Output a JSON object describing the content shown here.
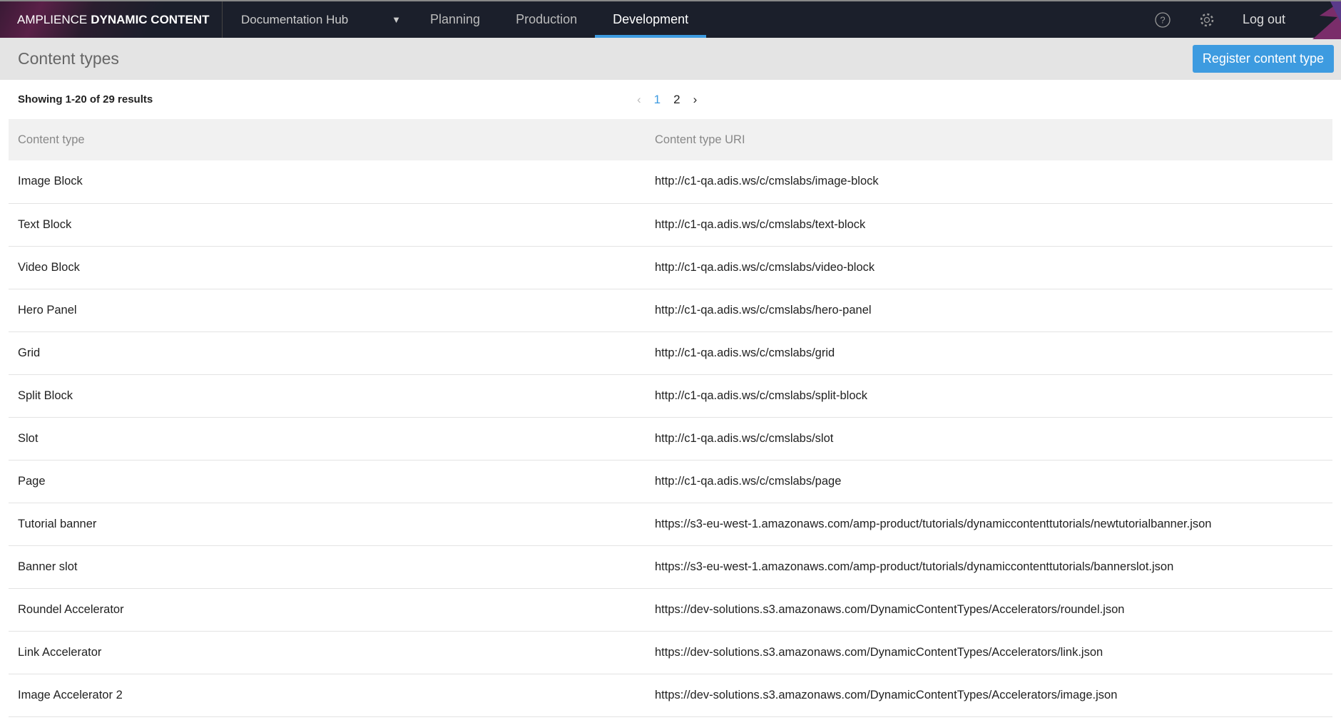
{
  "nav": {
    "brand_light": "AMPLIENCE",
    "brand_bold": "DYNAMIC CONTENT",
    "hub": "Documentation Hub",
    "tabs": [
      {
        "label": "Planning"
      },
      {
        "label": "Production"
      },
      {
        "label": "Development",
        "active": true
      }
    ],
    "help_icon": "help-circle-icon",
    "settings_icon": "gear-icon",
    "logout": "Log out"
  },
  "page": {
    "title": "Content types",
    "register_button": "Register content type",
    "showing": "Showing 1-20 of 29 results",
    "pages": [
      "1",
      "2"
    ],
    "current_page": "1"
  },
  "table": {
    "headers": [
      "Content type",
      "Content type URI"
    ],
    "rows": [
      [
        "Image Block",
        "http://c1-qa.adis.ws/c/cmslabs/image-block"
      ],
      [
        "Text Block",
        "http://c1-qa.adis.ws/c/cmslabs/text-block"
      ],
      [
        "Video Block",
        "http://c1-qa.adis.ws/c/cmslabs/video-block"
      ],
      [
        "Hero Panel",
        "http://c1-qa.adis.ws/c/cmslabs/hero-panel"
      ],
      [
        "Grid",
        "http://c1-qa.adis.ws/c/cmslabs/grid"
      ],
      [
        "Split Block",
        "http://c1-qa.adis.ws/c/cmslabs/split-block"
      ],
      [
        "Slot",
        "http://c1-qa.adis.ws/c/cmslabs/slot"
      ],
      [
        "Page",
        "http://c1-qa.adis.ws/c/cmslabs/page"
      ],
      [
        "Tutorial banner",
        "https://s3-eu-west-1.amazonaws.com/amp-product/tutorials/dynamiccontenttutorials/newtutorialbanner.json"
      ],
      [
        "Banner slot",
        "https://s3-eu-west-1.amazonaws.com/amp-product/tutorials/dynamiccontenttutorials/bannerslot.json"
      ],
      [
        "Roundel Accelerator",
        "https://dev-solutions.s3.amazonaws.com/DynamicContentTypes/Accelerators/roundel.json"
      ],
      [
        "Link Accelerator",
        "https://dev-solutions.s3.amazonaws.com/DynamicContentTypes/Accelerators/link.json"
      ],
      [
        "Image Accelerator 2",
        "https://dev-solutions.s3.amazonaws.com/DynamicContentTypes/Accelerators/image.json"
      ]
    ]
  },
  "colors": {
    "accent": "#3d9be0",
    "nav_bg": "#1b1f2b"
  }
}
